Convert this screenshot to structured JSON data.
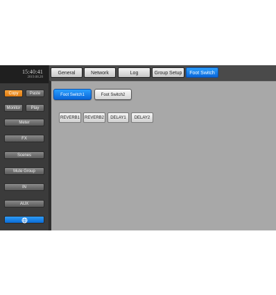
{
  "sidebar": {
    "time": "15:40:41",
    "date": "2019.08.20",
    "copy_label": "Copy",
    "paste_label": "Paste",
    "monitor_label": "Monitor",
    "play_label": "Play",
    "items": [
      {
        "label": "Meter"
      },
      {
        "label": "FX"
      },
      {
        "label": "Scenes"
      },
      {
        "label": "Mute Group"
      },
      {
        "label": "IN"
      },
      {
        "label": "AUX"
      }
    ],
    "bottom_icon": "network-globe-icon"
  },
  "tabs": [
    {
      "label": "General"
    },
    {
      "label": "Network"
    },
    {
      "label": "Log"
    },
    {
      "label": "Group Setup"
    },
    {
      "label": "Foot Switch",
      "active": true
    }
  ],
  "footswitch": {
    "buttons": [
      {
        "label": "Foot Switch1",
        "active": true
      },
      {
        "label": "Foot Switch2",
        "active": false
      }
    ],
    "assignments": [
      "REVERB1",
      "REVERB2",
      "DELAY1",
      "DELAY2"
    ]
  },
  "colors": {
    "accent_blue": "#0a66d8",
    "accent_orange": "#e07b10",
    "panel_gray": "#a8a8a8",
    "sidebar_dark": "#3b3b3b"
  }
}
